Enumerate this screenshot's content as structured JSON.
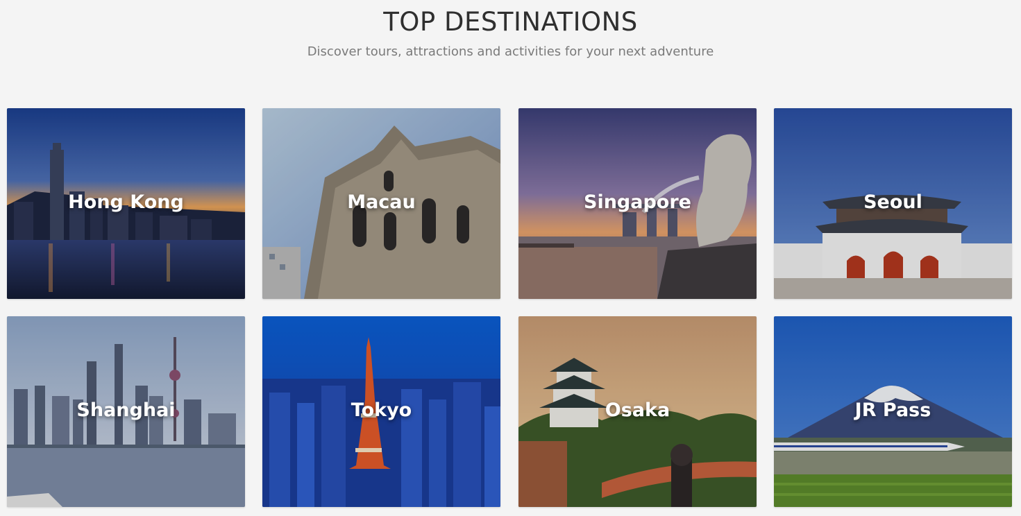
{
  "section": {
    "title": "TOP DESTINATIONS",
    "subtitle": "Discover tours, attractions and activities for your next adventure"
  },
  "destinations": [
    {
      "name": "Hong Kong",
      "image": "hong-kong-skyline-image"
    },
    {
      "name": "Macau",
      "image": "ruins-of-st-pauls-image"
    },
    {
      "name": "Singapore",
      "image": "merlion-image"
    },
    {
      "name": "Seoul",
      "image": "gyeongbokgung-gate-image"
    },
    {
      "name": "Shanghai",
      "image": "shanghai-skyline-image"
    },
    {
      "name": "Tokyo",
      "image": "tokyo-tower-image"
    },
    {
      "name": "Osaka",
      "image": "osaka-castle-image"
    },
    {
      "name": "JR Pass",
      "image": "mount-fuji-shinkansen-image"
    }
  ]
}
